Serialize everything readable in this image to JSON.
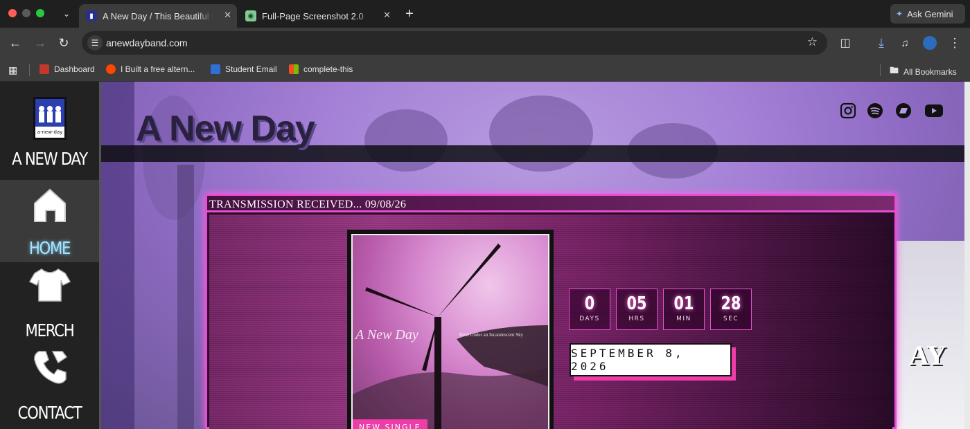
{
  "browser": {
    "tabs": [
      {
        "label": "A New Day / This Beautiful De",
        "active": true
      },
      {
        "label": "Full-Page Screenshot 2.0",
        "active": false
      }
    ],
    "ask_gemini": "Ask Gemini",
    "url": "anewdayband.com",
    "bookmarks": [
      "Dashboard",
      "I Built a free altern...",
      "Student Email",
      "complete-this"
    ],
    "all_bookmarks": "All Bookmarks"
  },
  "sidebar": {
    "logo_text": "A NEW DAY",
    "logo_caption": "a-new-day",
    "nav": [
      {
        "label": "HOME",
        "icon": "home-icon",
        "active": true
      },
      {
        "label": "MERCH",
        "icon": "shirt-icon",
        "active": false
      },
      {
        "label": "CONTACT",
        "icon": "phone-icon",
        "active": false
      }
    ]
  },
  "hero": {
    "site_title": "A New Day",
    "social": [
      "instagram-icon",
      "spotify-icon",
      "bandcamp-icon",
      "youtube-icon"
    ],
    "bg_text": "AY"
  },
  "card": {
    "header": "TRANSMISSION RECEIVED... 09/08/26",
    "album": {
      "band": "A New Day",
      "subtitle": "Held Under an Incandescent Sky",
      "badge": "NEW SINGLE"
    },
    "countdown": [
      {
        "value": "0",
        "unit": "DAYS"
      },
      {
        "value": "05",
        "unit": "HRS"
      },
      {
        "value": "01",
        "unit": "MIN"
      },
      {
        "value": "28",
        "unit": "SEC"
      }
    ],
    "date": "SEPTEMBER 8, 2026"
  },
  "colors": {
    "accent": "#e84ed3",
    "badge": "#ee3ca8",
    "hero_bg": "#a481d6"
  }
}
